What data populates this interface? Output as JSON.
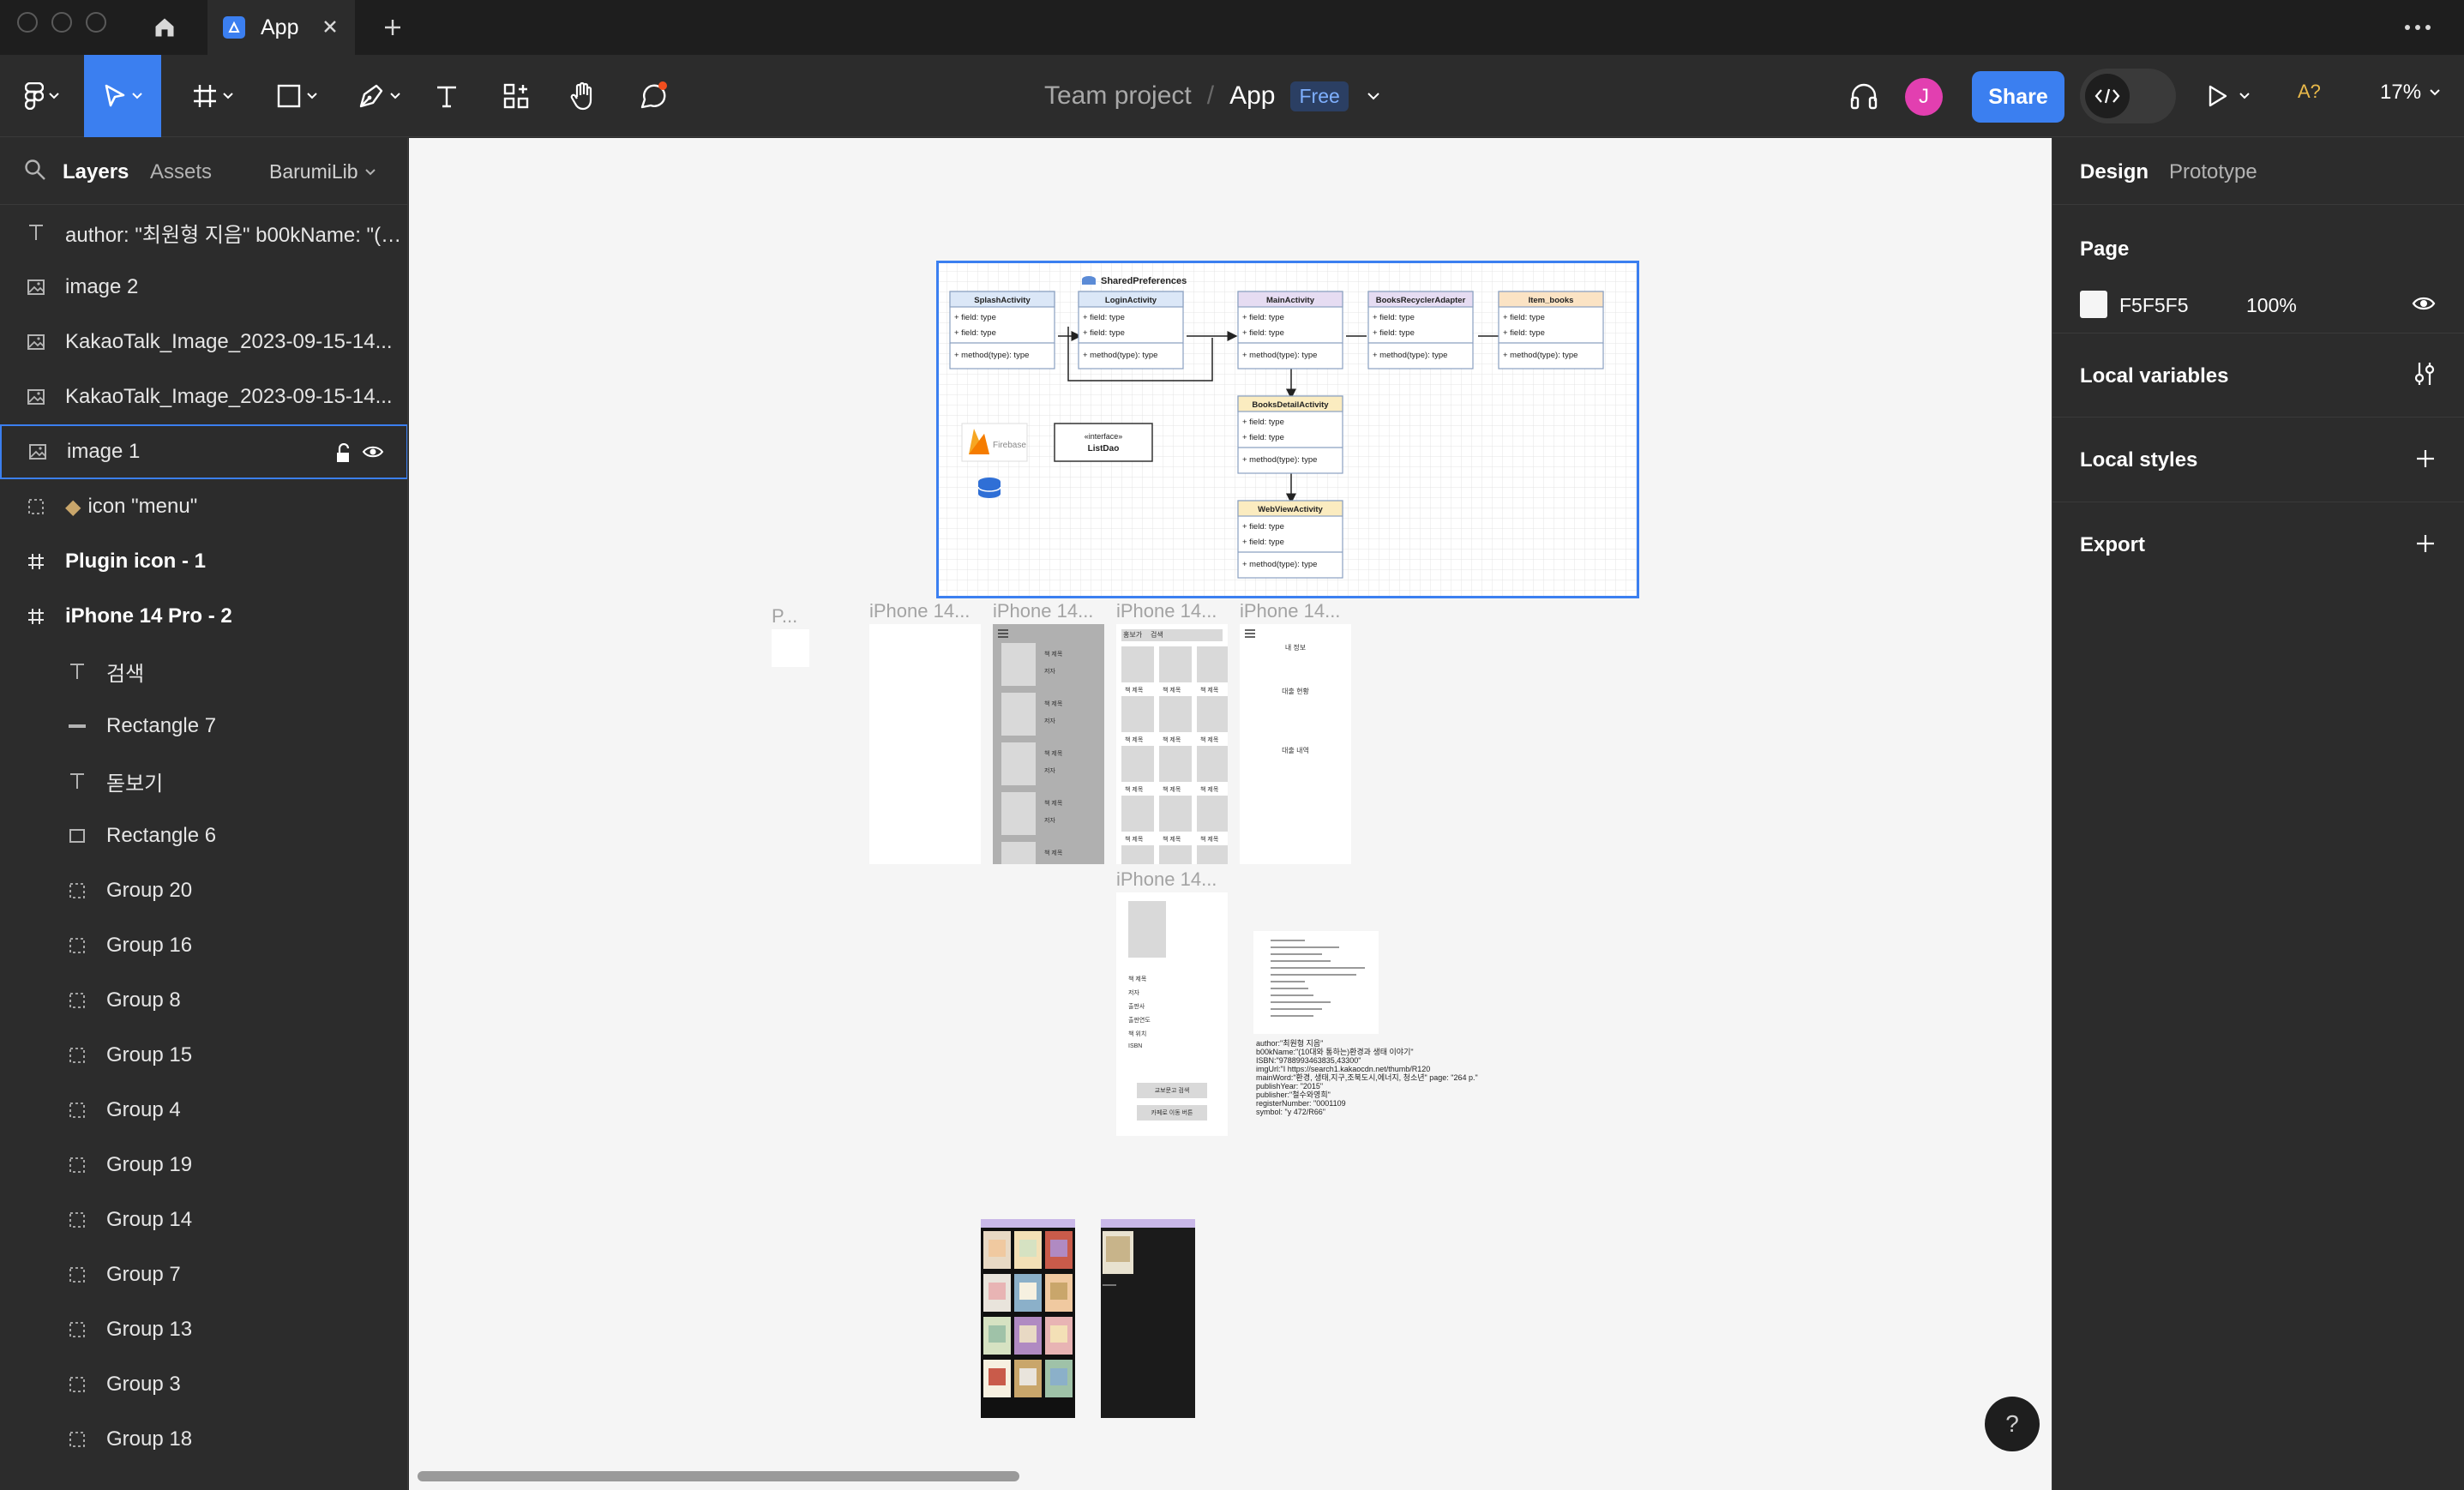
{
  "tabbar": {
    "file_tab_name": "App",
    "more_label": "···"
  },
  "toolbar": {
    "team": "Team project",
    "separator": "/",
    "file_name": "App",
    "plan_badge": "Free",
    "avatar_initial": "J",
    "share_label": "Share",
    "a11y_label": "A?",
    "zoom_label": "17%"
  },
  "left_panel": {
    "tabs": {
      "layers": "Layers",
      "assets": "Assets"
    },
    "library": "BarumiLib",
    "layers": [
      {
        "name": "author: \"최원형 지음\" b00kName: \"(1...",
        "icon": "text-icon",
        "indent": 0,
        "bold": false
      },
      {
        "name": "image 2",
        "icon": "image-icon",
        "indent": 0,
        "bold": false
      },
      {
        "name": "KakaoTalk_Image_2023-09-15-14...",
        "icon": "image-icon",
        "indent": 0,
        "bold": false
      },
      {
        "name": "KakaoTalk_Image_2023-09-15-14...",
        "icon": "image-icon",
        "indent": 0,
        "bold": false
      },
      {
        "name": "image 1",
        "icon": "image-icon",
        "indent": 0,
        "bold": false,
        "selected": true
      },
      {
        "name": "icon \"menu\"",
        "icon": "group-icon",
        "indent": 0,
        "bold": false
      },
      {
        "name": "Plugin icon - 1",
        "icon": "frame-icon",
        "indent": 0,
        "bold": true
      },
      {
        "name": "iPhone 14 Pro - 2",
        "icon": "frame-icon",
        "indent": 0,
        "bold": true
      },
      {
        "name": "검색",
        "icon": "text-icon",
        "indent": 1,
        "bold": false
      },
      {
        "name": "Rectangle 7",
        "icon": "line-icon",
        "indent": 1,
        "bold": false
      },
      {
        "name": "돋보기",
        "icon": "text-icon",
        "indent": 1,
        "bold": false
      },
      {
        "name": "Rectangle 6",
        "icon": "rectangle-icon",
        "indent": 1,
        "bold": false
      },
      {
        "name": "Group 20",
        "icon": "group-icon",
        "indent": 1,
        "bold": false
      },
      {
        "name": "Group 16",
        "icon": "group-icon",
        "indent": 1,
        "bold": false
      },
      {
        "name": "Group 8",
        "icon": "group-icon",
        "indent": 1,
        "bold": false
      },
      {
        "name": "Group 15",
        "icon": "group-icon",
        "indent": 1,
        "bold": false
      },
      {
        "name": "Group 4",
        "icon": "group-icon",
        "indent": 1,
        "bold": false
      },
      {
        "name": "Group 19",
        "icon": "group-icon",
        "indent": 1,
        "bold": false
      },
      {
        "name": "Group 14",
        "icon": "group-icon",
        "indent": 1,
        "bold": false
      },
      {
        "name": "Group 7",
        "icon": "group-icon",
        "indent": 1,
        "bold": false
      },
      {
        "name": "Group 13",
        "icon": "group-icon",
        "indent": 1,
        "bold": false
      },
      {
        "name": "Group 3",
        "icon": "group-icon",
        "indent": 1,
        "bold": false
      },
      {
        "name": "Group 18",
        "icon": "group-icon",
        "indent": 1,
        "bold": false
      }
    ]
  },
  "canvas": {
    "background": "#F5F5F5",
    "diagram": {
      "shared_prefs": "SharedPreferences",
      "classes": [
        {
          "name": "SplashActivity",
          "color": "#dbe7f7",
          "f1": "+ field: type",
          "f2": "+ field: type",
          "m": "+ method(type): type"
        },
        {
          "name": "LoginActivity",
          "color": "#dbe7f7",
          "f1": "+ field: type",
          "f2": "+ field: type",
          "m": "+ method(type): type"
        },
        {
          "name": "MainActivity",
          "color": "#e6dcf2",
          "f1": "+ field: type",
          "f2": "+ field: type",
          "m": "+ method(type): type"
        },
        {
          "name": "BooksRecyclerAdapter",
          "color": "#e6dcf2",
          "f1": "+ field: type",
          "f2": "+ field: type",
          "m": "+ method(type): type"
        },
        {
          "name": "Item_books",
          "color": "#fbe3c4",
          "f1": "+ field: type",
          "f2": "+ field: type",
          "m": "+ method(type): type"
        },
        {
          "name": "BooksDetailActivity",
          "color": "#fbecc0",
          "f1": "+ field: type",
          "f2": "+ field: type",
          "m": "+ method(type): type"
        },
        {
          "name": "WebViewActivity",
          "color": "#fbecc0",
          "f1": "+ field: type",
          "f2": "+ field: type",
          "m": "+ method(type): type"
        }
      ],
      "firebase": "Firebase",
      "interface_stereo": "«interface»",
      "interface_name": "ListDao"
    },
    "frame_labels": [
      "P...",
      "iPhone 14...",
      "iPhone 14...",
      "iPhone 14...",
      "iPhone 14...",
      "iPhone 14..."
    ],
    "list_item_title": "책 제목",
    "list_item_sub": "저자",
    "grid_tabs": [
      "홍보가",
      "검색"
    ],
    "info_labels": [
      "내 정보",
      "대출 현황",
      "대출 내역"
    ],
    "detail_fields": [
      "책 제목",
      "저자",
      "출판사",
      "출판연도",
      "책 위치",
      "ISBN"
    ],
    "detail_buttons": [
      "교보문고 검색",
      "카페로 이동 버튼"
    ],
    "json_text": [
      "author:\"최원형 지음\"",
      "b00kName:\"(10대와 통하는)환경과 생태 이야기\"",
      "ISBN:\"9788993463835,43300\"",
      "imgUrl:\"I https://search1.kakaocdn.net/thumb/R120",
      "mainWord:\"환경, 생태,지구,조북도시,에너지, 청소년\" page: \"264 p.\"",
      "publishYear: \"2015\"",
      "publisher:\"철수와영희\"",
      "registerNumber: \"0001109",
      "symbol: \"y 472/R66\""
    ]
  },
  "right_panel": {
    "tabs": {
      "design": "Design",
      "prototype": "Prototype"
    },
    "page_title": "Page",
    "page_color": "F5F5F5",
    "page_opacity": "100%",
    "local_variables": "Local variables",
    "local_styles": "Local styles",
    "export": "Export"
  },
  "help_label": "?"
}
